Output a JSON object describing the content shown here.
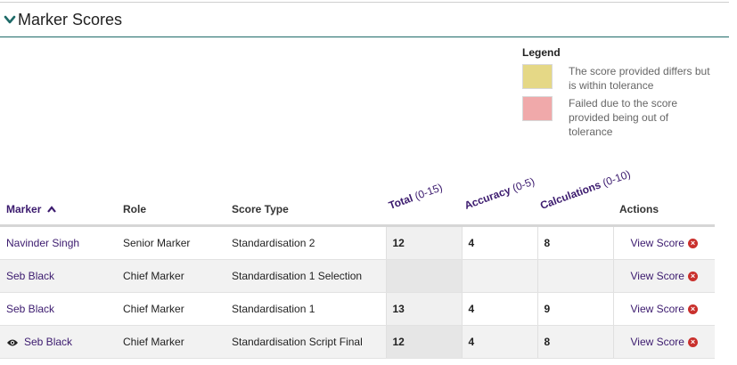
{
  "section": {
    "title": "Marker Scores"
  },
  "legend": {
    "title": "Legend",
    "items": [
      {
        "color": "#e5d886",
        "text": "The score provided differs but is within tolerance"
      },
      {
        "color": "#f0a9aa",
        "text": "Failed due to the score provided being out of tolerance"
      }
    ]
  },
  "table": {
    "columns": {
      "marker": "Marker",
      "role": "Role",
      "score_type": "Score Type",
      "total": "Total",
      "total_range": "(0-15)",
      "accuracy": "Accuracy",
      "accuracy_range": "(0-5)",
      "calculations": "Calculations",
      "calculations_range": "(0-10)",
      "actions": "Actions"
    },
    "rows": [
      {
        "marker": "Navinder Singh",
        "role": "Senior Marker",
        "score_type": "Standardisation 2",
        "total": "12",
        "accuracy": "4",
        "calculations": "8",
        "action": "View Score"
      },
      {
        "marker": "Seb Black",
        "role": "Chief Marker",
        "score_type": "Standardisation 1 Selection",
        "total": "",
        "accuracy": "",
        "calculations": "",
        "action": "View Score"
      },
      {
        "marker": "Seb Black",
        "role": "Chief Marker",
        "score_type": "Standardisation 1",
        "total": "13",
        "accuracy": "4",
        "calculations": "9",
        "action": "View Score"
      },
      {
        "marker": "Seb Black",
        "role": "Chief Marker",
        "score_type": "Standardisation Script Final",
        "total": "12",
        "accuracy": "4",
        "calculations": "8",
        "action": "View Score"
      }
    ]
  },
  "icons": {
    "section_toggle": "chevron-down-icon",
    "sort": "sort-up-icon",
    "remove": "x-circle-icon",
    "viewed": "eye-icon"
  }
}
